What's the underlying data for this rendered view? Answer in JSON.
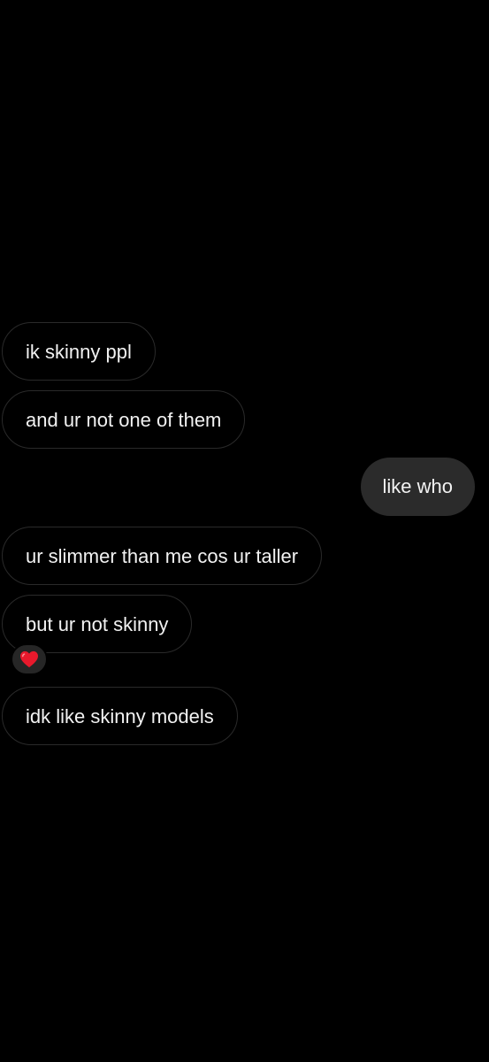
{
  "chat": {
    "messages": [
      {
        "text": "ik skinny ppl",
        "direction": "received"
      },
      {
        "text": "and ur not one of them",
        "direction": "received"
      },
      {
        "text": "like who",
        "direction": "sent"
      },
      {
        "text": "ur slimmer than me cos ur taller",
        "direction": "received"
      },
      {
        "text": "but ur not skinny",
        "direction": "received",
        "reaction": "heart-icon"
      },
      {
        "text": "idk like skinny models",
        "direction": "received"
      }
    ]
  },
  "colors": {
    "background": "#000000",
    "sent_bubble": "#2b2b2b",
    "received_border": "#2a2a2a",
    "text": "#f2f2f2",
    "reaction_heart": "#e8192c"
  }
}
